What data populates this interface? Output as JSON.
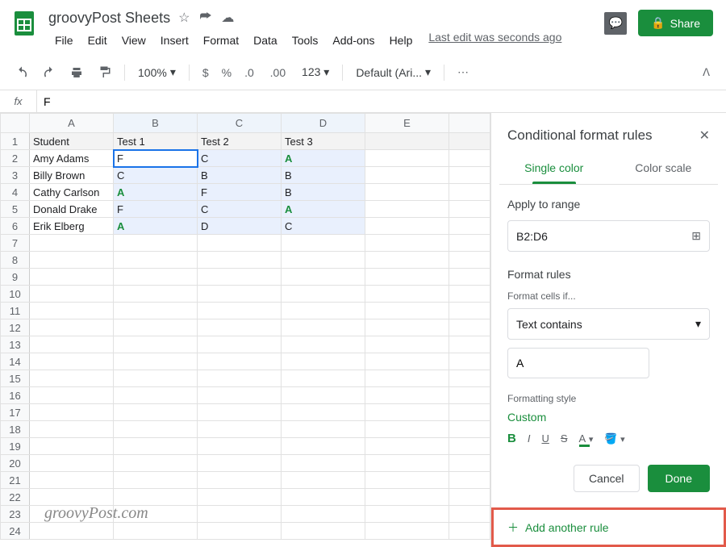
{
  "doc_title": "groovyPost Sheets",
  "menu": [
    "File",
    "Edit",
    "View",
    "Insert",
    "Format",
    "Data",
    "Tools",
    "Add-ons",
    "Help"
  ],
  "last_edit": "Last edit was seconds ago",
  "share_label": "Share",
  "toolbar": {
    "zoom": "100%",
    "font": "Default (Ari..."
  },
  "formula_value": "F",
  "columns": [
    "A",
    "B",
    "C",
    "D",
    "E"
  ],
  "rows": [
    {
      "n": 1,
      "cells": [
        "Student",
        "Test 1",
        "Test 2",
        "Test 3",
        ""
      ]
    },
    {
      "n": 2,
      "cells": [
        "Amy Adams",
        "F",
        "C",
        "A",
        ""
      ]
    },
    {
      "n": 3,
      "cells": [
        "Billy Brown",
        "C",
        "B",
        "B",
        ""
      ]
    },
    {
      "n": 4,
      "cells": [
        "Cathy Carlson",
        "A",
        "F",
        "B",
        ""
      ]
    },
    {
      "n": 5,
      "cells": [
        "Donald Drake",
        "F",
        "C",
        "A",
        ""
      ]
    },
    {
      "n": 6,
      "cells": [
        "Erik Elberg",
        "A",
        "D",
        "C",
        ""
      ]
    },
    {
      "n": 7,
      "cells": [
        "",
        "",
        "",
        "",
        ""
      ]
    },
    {
      "n": 8,
      "cells": [
        "",
        "",
        "",
        "",
        ""
      ]
    },
    {
      "n": 9,
      "cells": [
        "",
        "",
        "",
        "",
        ""
      ]
    },
    {
      "n": 10,
      "cells": [
        "",
        "",
        "",
        "",
        ""
      ]
    },
    {
      "n": 11,
      "cells": [
        "",
        "",
        "",
        "",
        ""
      ]
    },
    {
      "n": 12,
      "cells": [
        "",
        "",
        "",
        "",
        ""
      ]
    },
    {
      "n": 13,
      "cells": [
        "",
        "",
        "",
        "",
        ""
      ]
    },
    {
      "n": 14,
      "cells": [
        "",
        "",
        "",
        "",
        ""
      ]
    },
    {
      "n": 15,
      "cells": [
        "",
        "",
        "",
        "",
        ""
      ]
    },
    {
      "n": 16,
      "cells": [
        "",
        "",
        "",
        "",
        ""
      ]
    },
    {
      "n": 17,
      "cells": [
        "",
        "",
        "",
        "",
        ""
      ]
    },
    {
      "n": 18,
      "cells": [
        "",
        "",
        "",
        "",
        ""
      ]
    },
    {
      "n": 19,
      "cells": [
        "",
        "",
        "",
        "",
        ""
      ]
    },
    {
      "n": 20,
      "cells": [
        "",
        "",
        "",
        "",
        ""
      ]
    },
    {
      "n": 21,
      "cells": [
        "",
        "",
        "",
        "",
        ""
      ]
    },
    {
      "n": 22,
      "cells": [
        "",
        "",
        "",
        "",
        ""
      ]
    },
    {
      "n": 23,
      "cells": [
        "",
        "",
        "",
        "",
        ""
      ]
    },
    {
      "n": 24,
      "cells": [
        "",
        "",
        "",
        "",
        ""
      ]
    }
  ],
  "sidebar": {
    "title": "Conditional format rules",
    "tab_single": "Single color",
    "tab_scale": "Color scale",
    "apply_label": "Apply to range",
    "range": "B2:D6",
    "rules_label": "Format rules",
    "condition_label": "Format cells if...",
    "condition": "Text contains",
    "value": "A",
    "style_label": "Formatting style",
    "style_name": "Custom",
    "cancel": "Cancel",
    "done": "Done",
    "add_rule": "Add another rule"
  },
  "watermark": "groovyPost.com"
}
